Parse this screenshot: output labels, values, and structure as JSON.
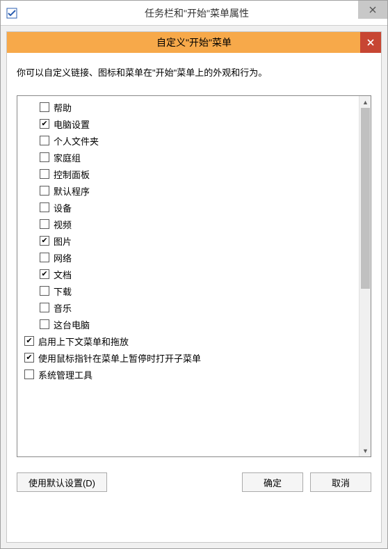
{
  "outerTitle": "任务栏和\"开始\"菜单属性",
  "innerTitle": "自定义\"开始\"菜单",
  "description": "你可以自定义链接、图标和菜单在\"开始\"菜单上的外观和行为。",
  "items": [
    {
      "label": "帮助",
      "checked": false,
      "indent": true
    },
    {
      "label": "电脑设置",
      "checked": true,
      "indent": true
    },
    {
      "label": "个人文件夹",
      "checked": false,
      "indent": true
    },
    {
      "label": "家庭组",
      "checked": false,
      "indent": true
    },
    {
      "label": "控制面板",
      "checked": false,
      "indent": true
    },
    {
      "label": "默认程序",
      "checked": false,
      "indent": true
    },
    {
      "label": "设备",
      "checked": false,
      "indent": true
    },
    {
      "label": "视频",
      "checked": false,
      "indent": true
    },
    {
      "label": "图片",
      "checked": true,
      "indent": true
    },
    {
      "label": "网络",
      "checked": false,
      "indent": true
    },
    {
      "label": "文档",
      "checked": true,
      "indent": true
    },
    {
      "label": "下载",
      "checked": false,
      "indent": true
    },
    {
      "label": "音乐",
      "checked": false,
      "indent": true
    },
    {
      "label": "这台电脑",
      "checked": false,
      "indent": true
    },
    {
      "label": "启用上下文菜单和拖放",
      "checked": true,
      "indent": false
    },
    {
      "label": "使用鼠标指针在菜单上暂停时打开子菜单",
      "checked": true,
      "indent": false
    },
    {
      "label": "系统管理工具",
      "checked": false,
      "indent": false
    }
  ],
  "buttons": {
    "defaults": "使用默认设置(D)",
    "ok": "确定",
    "cancel": "取消"
  }
}
